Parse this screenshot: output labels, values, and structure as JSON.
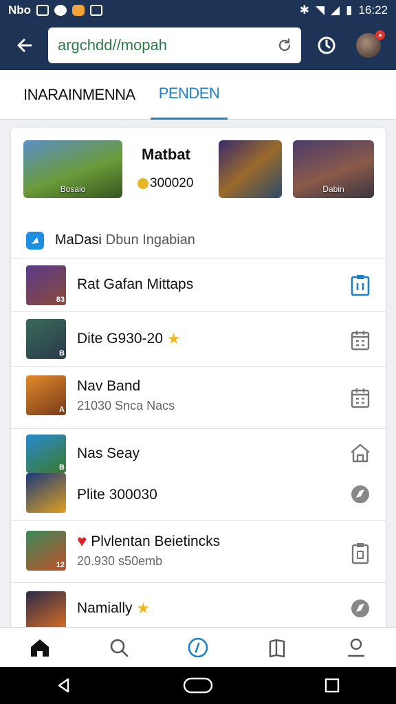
{
  "status": {
    "left_text": "Nbo",
    "time": "16:22"
  },
  "url": {
    "value": "argchdd//mopah"
  },
  "tabs": [
    {
      "label": "INARAINMENNA"
    },
    {
      "label": "PENDEN"
    }
  ],
  "featured": {
    "title": "Matbat",
    "price": "300020",
    "thumbs": [
      {
        "caption": "Bosaio"
      },
      {
        "caption": ""
      },
      {
        "caption": "Dabin"
      }
    ]
  },
  "section": {
    "title": "MaDasi",
    "subtitle": "Dbun Ingabian"
  },
  "list": [
    {
      "name": "Rat Gafan Mittaps",
      "sub": "",
      "tag": "83",
      "star": false,
      "heart": false,
      "icon": "clipboard-icon"
    },
    {
      "name": "Dite G930-20",
      "sub": "",
      "tag": "B",
      "star": true,
      "heart": false,
      "icon": "calendar-icon"
    },
    {
      "name": "Nav Band",
      "sub": "21030 Snca Nacs",
      "tag": "A",
      "star": false,
      "heart": false,
      "icon": "calendar-icon"
    },
    {
      "name": "Nas Seay",
      "sub": "",
      "tag": "B",
      "star": false,
      "heart": false,
      "icon": "home-icon"
    },
    {
      "name": "Plite 300030",
      "sub": "",
      "tag": "",
      "star": false,
      "heart": false,
      "icon": "compass-icon"
    },
    {
      "name": "Plvlentan Beietincks",
      "sub": "20.930 s50emb",
      "tag": "12",
      "star": false,
      "heart": true,
      "icon": "clipboard-icon"
    },
    {
      "name": "Namially",
      "sub": "",
      "tag": "",
      "star": true,
      "heart": false,
      "icon": "compass-icon"
    }
  ],
  "colors": {
    "primary": "#1d3457",
    "accent": "#1d7fc4"
  }
}
